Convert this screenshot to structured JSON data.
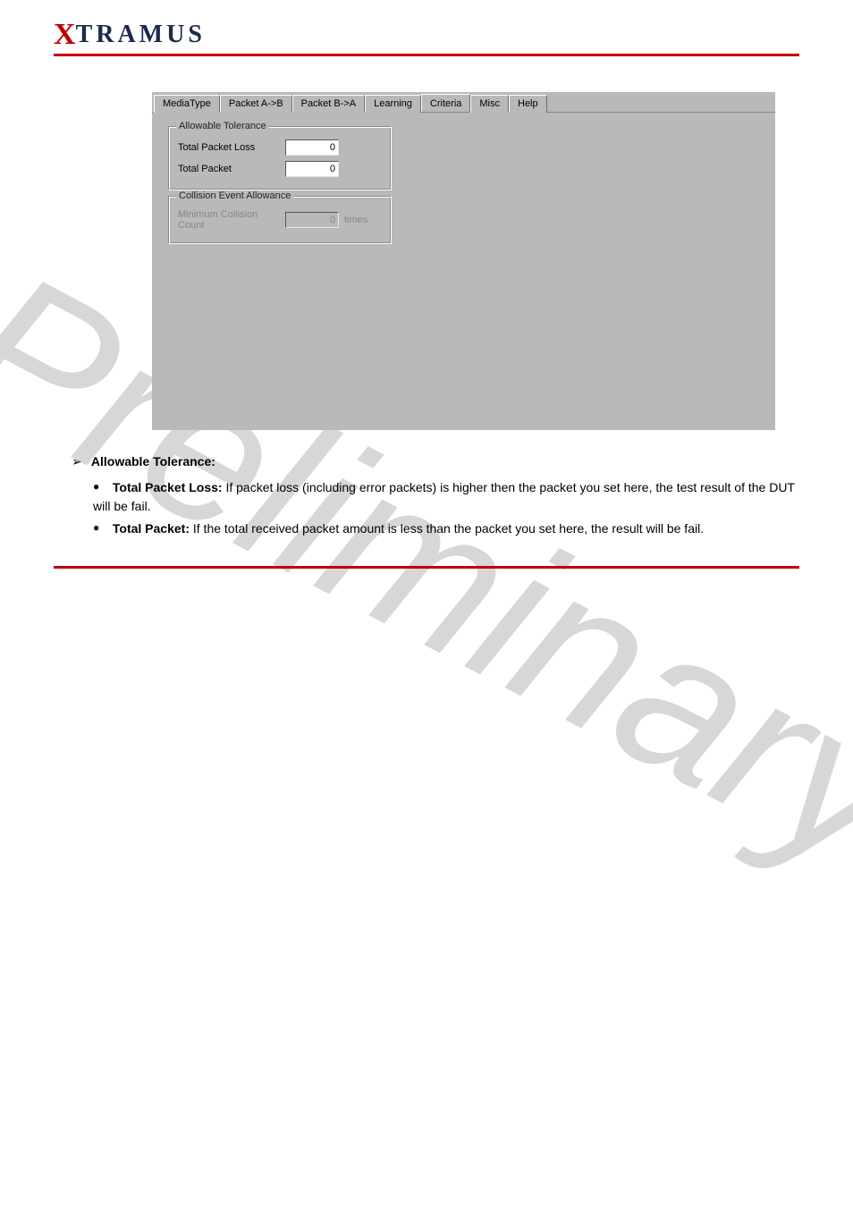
{
  "brand": {
    "x": "X",
    "rest": "TRAMUS"
  },
  "watermark": "Preliminary",
  "tabs": {
    "t0": "MediaType",
    "t1": "Packet A->B",
    "t2": "Packet B->A",
    "t3": "Learning",
    "t4": "Criteria",
    "t5": "Misc",
    "t6": "Help"
  },
  "group_allowable": {
    "legend": "Allowable Tolerance",
    "row1_label": "Total Packet Loss",
    "row1_value": "0",
    "row2_label": "Total Packet",
    "row2_value": "0"
  },
  "group_collision": {
    "legend": "Collision Event Allowance",
    "row1_label": "Minimum Collision Count",
    "row1_value": "0",
    "row1_unit": "times"
  },
  "doc": {
    "allowable_head": "Allowable Tolerance:",
    "tpl_head": "Total Packet Loss:",
    "tpl_body": " If packet loss (including error packets) is higher then the packet you set here, the test result of the DUT will be fail.",
    "tp_head": "Total Packet:",
    "tp_body": " If the total received packet amount is less than the packet you set here, the result will be fail."
  }
}
